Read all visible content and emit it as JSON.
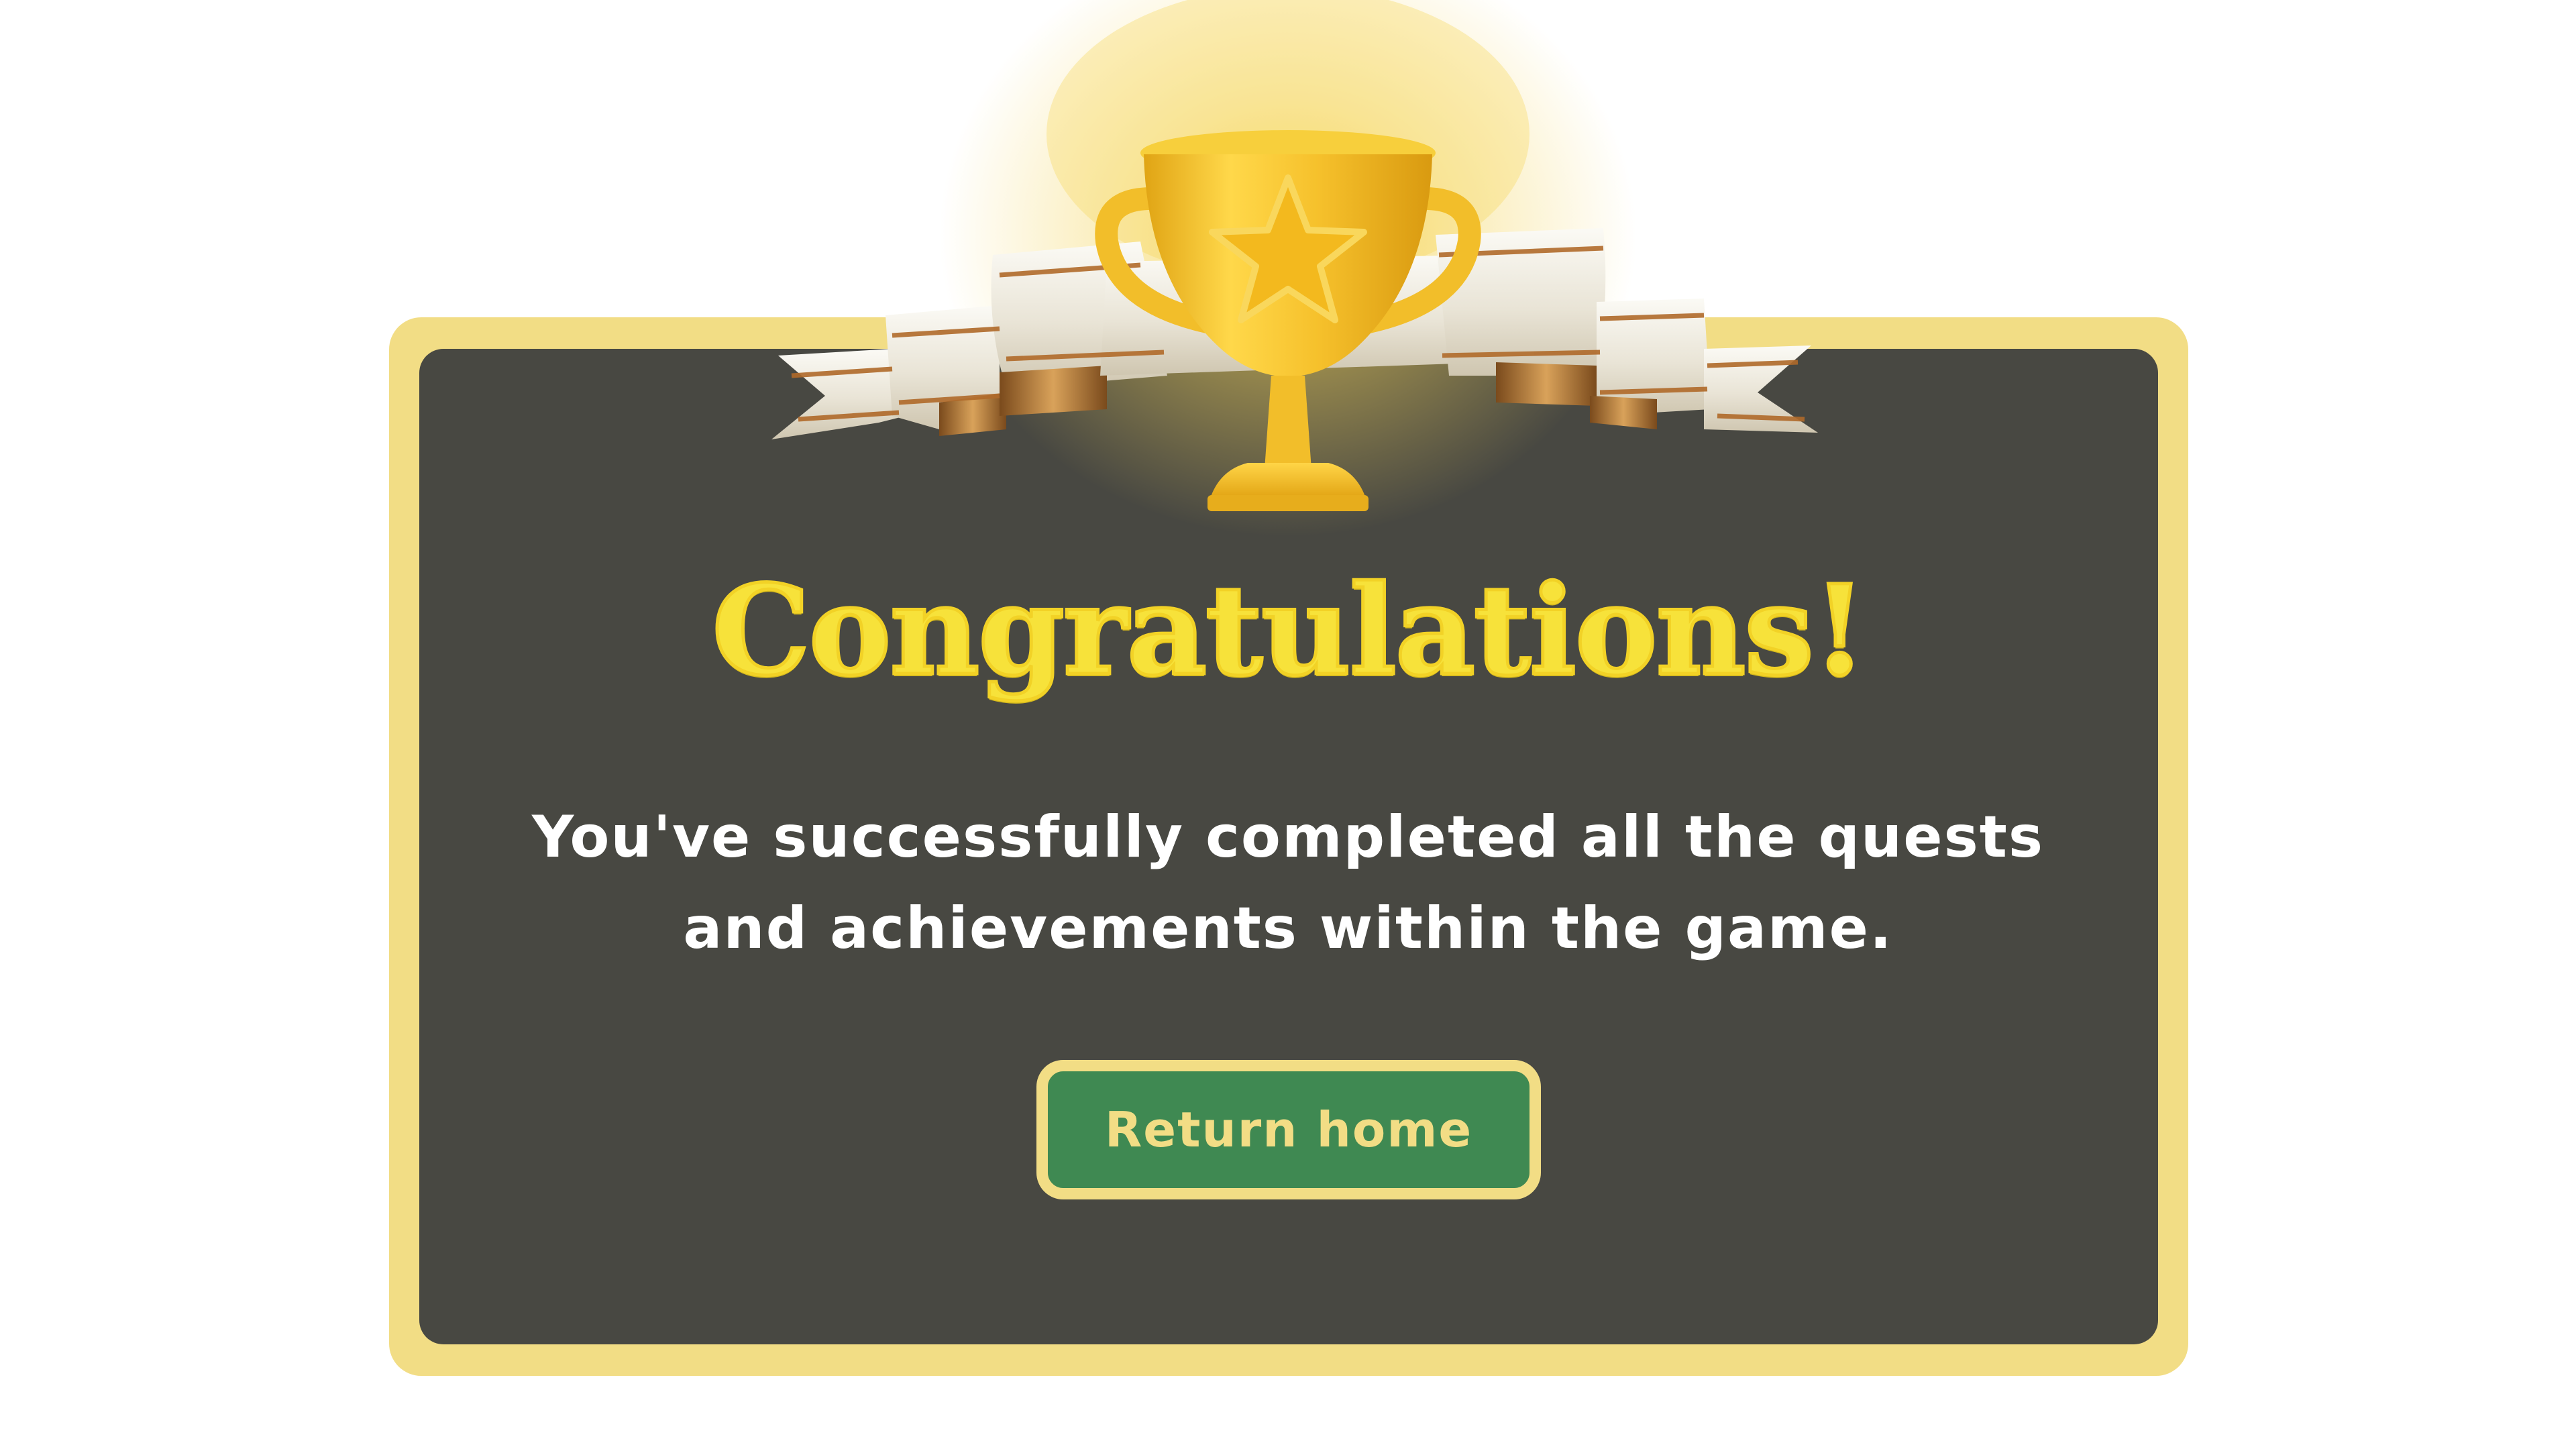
{
  "dialog": {
    "title": "Congratulations!",
    "message": "You've successfully completed all the quests and achievements within the game.",
    "button_label": "Return home"
  },
  "icons": {
    "trophy": "trophy-icon",
    "star": "star-icon",
    "ribbon": "ribbon-banner"
  },
  "colors": {
    "frame": "#f2dd85",
    "panel": "#484842",
    "title": "#f7e23a",
    "button": "#3f8952",
    "button_text": "#f2dd85",
    "text": "#ffffff",
    "trophy_gold": "#f2be2a"
  }
}
